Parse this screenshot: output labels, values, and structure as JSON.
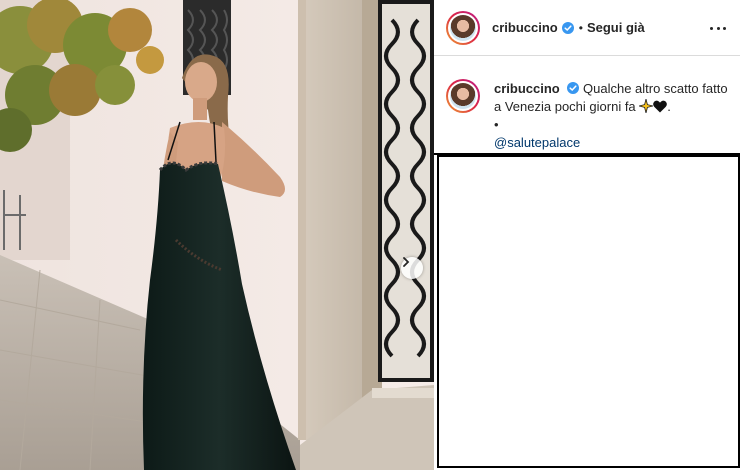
{
  "post": {
    "username": "cribuccino",
    "verified": true,
    "separator": "•",
    "follow_status": "Segui già",
    "caption": {
      "username": "cribuccino",
      "text_line1": "Qualche altro scatto",
      "text_line2": "fatto a Venezia pochi giorni fa",
      "text_tail": ".",
      "bullet": "•",
      "mention": "@salutepalace"
    }
  },
  "icons": {
    "verified": "verified-badge-icon",
    "more": "more-options-icon",
    "next": "chevron-right-icon",
    "emojis": [
      "sparkles-emoji",
      "black-heart-emoji"
    ]
  },
  "colors": {
    "verified_blue": "#3897f0",
    "mention_link": "#00376b",
    "text": "#262626",
    "divider": "#dbdbdb"
  }
}
